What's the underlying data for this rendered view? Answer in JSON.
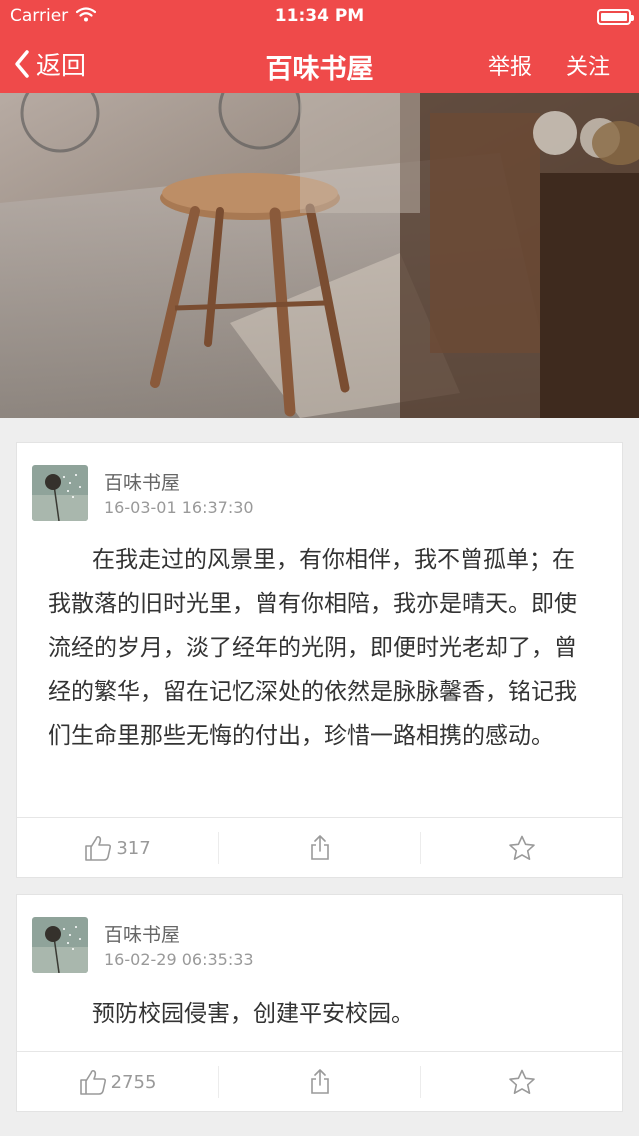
{
  "status_bar": {
    "carrier": "Carrier",
    "time": "11:34 PM"
  },
  "nav": {
    "back_label": "返回",
    "title": "百味书屋",
    "report_label": "举报",
    "follow_label": "关注"
  },
  "posts": [
    {
      "author": "百味书屋",
      "time": "16-03-01 16:37:30",
      "content": "在我走过的风景里，有你相伴，我不曾孤单；在我散落的旧时光里，曾有你相陪，我亦是晴天。即使流经的岁月，淡了经年的光阴，即便时光老却了，曾经的繁华，留在记忆深处的依然是脉脉馨香，铭记我们生命里那些无悔的付出，珍惜一路相携的感动。",
      "likes": "317"
    },
    {
      "author": "百味书屋",
      "time": "16-02-29 06:35:33",
      "content": "预防校园侵害，创建平安校园。",
      "likes": "2755"
    }
  ],
  "colors": {
    "accent": "#ef4a4a",
    "card_bg": "#ffffff",
    "page_bg": "#eeeeee"
  }
}
